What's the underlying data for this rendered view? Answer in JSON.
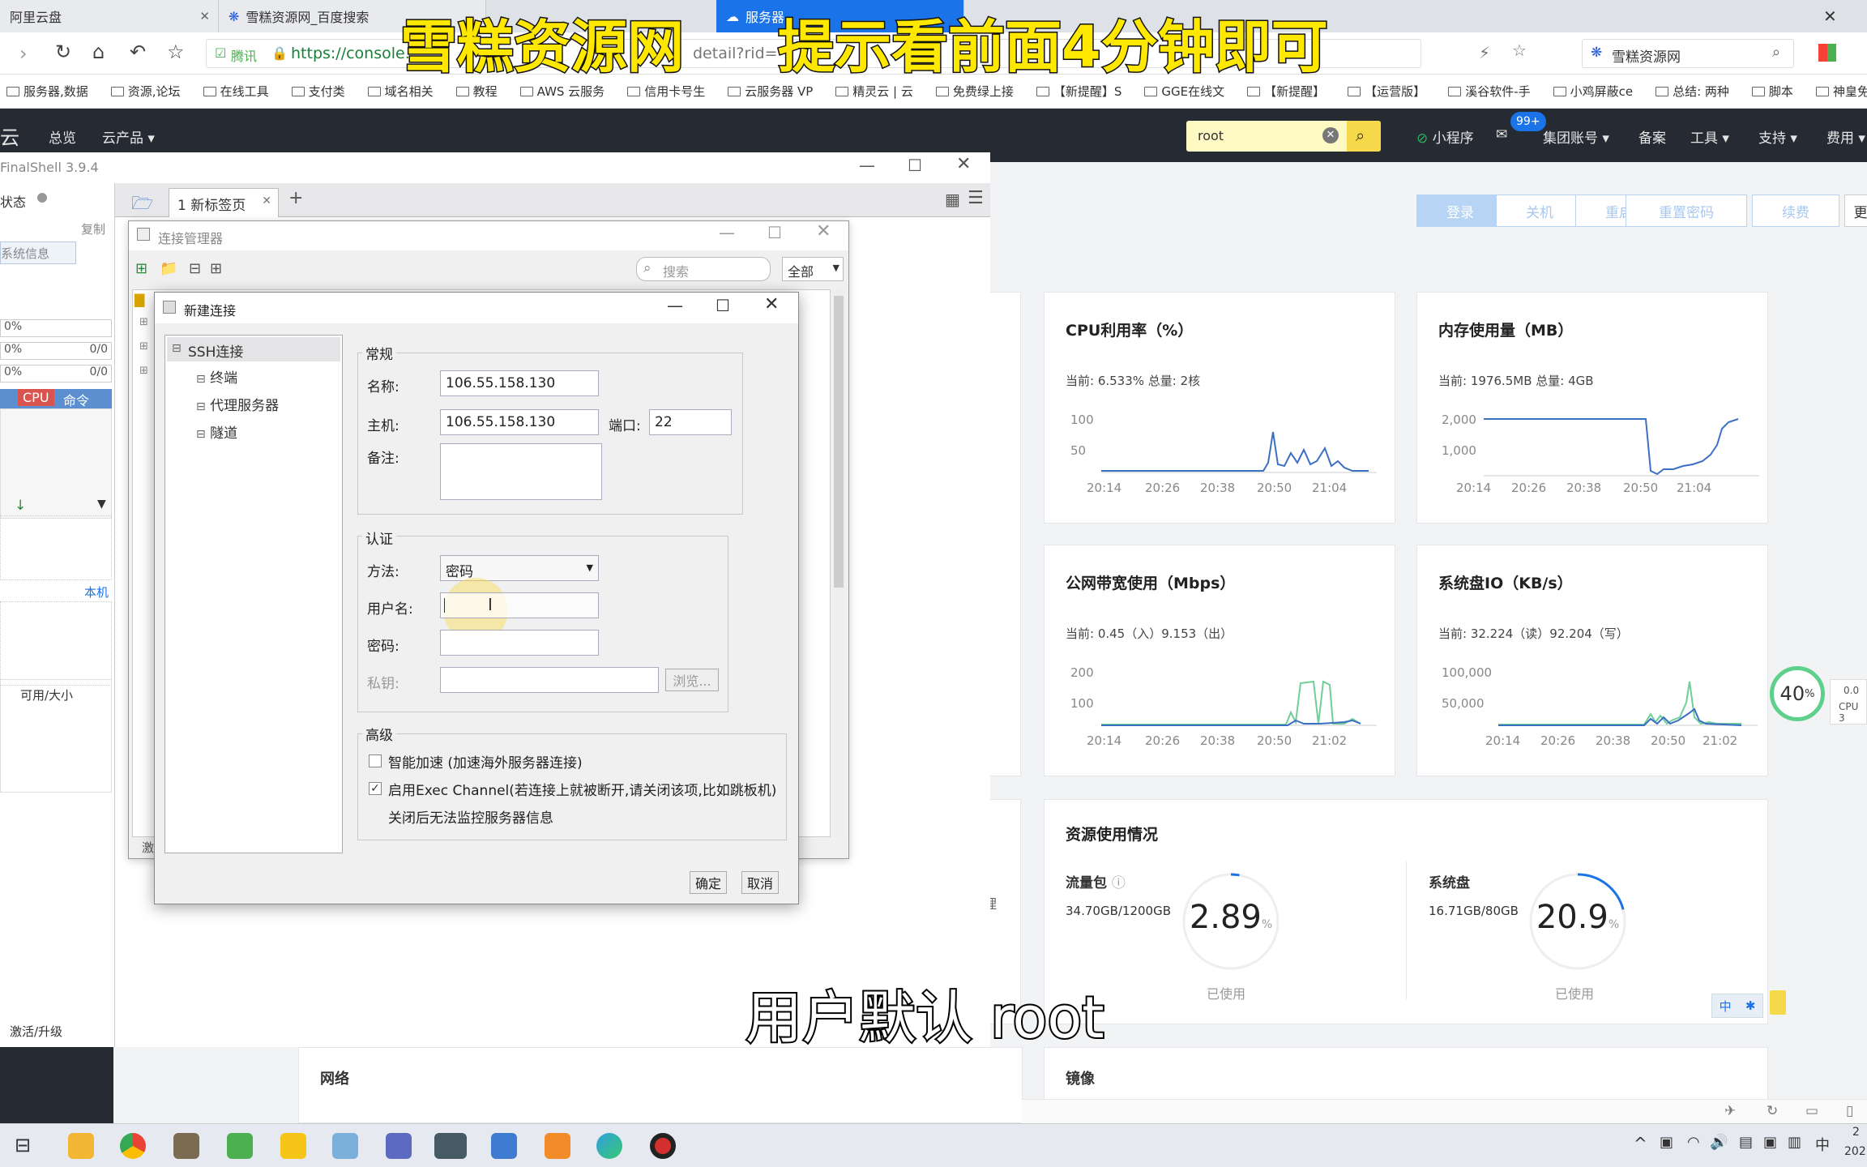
{
  "browser": {
    "tabs": [
      {
        "label": "阿里云盘"
      },
      {
        "label": "雪糕资源网_百度搜索"
      },
      {
        "label": "服务器"
      }
    ],
    "url": "https://console.",
    "url_suffix": "detail?rid=",
    "secure_label": "腾讯",
    "search_engine_label": "雪糕资源网",
    "bookmarks": [
      "服务器,数据",
      "资源,论坛",
      "在线工具",
      "支付类",
      "域名相关",
      "教程",
      "AWS 云服务",
      "信用卡号生",
      "云服务器 VP",
      "精灵云 | 云",
      "免费绿上接",
      "【新提醒】S",
      "GGE在线文",
      "【新提醒】",
      "【运营版】",
      "溪谷软件-手",
      "小鸡屏蔽ce",
      "总结: 两种",
      "脚本",
      "神皇免费"
    ]
  },
  "console": {
    "logo": "云",
    "nav": [
      "总览",
      "云产品"
    ],
    "search_value": "root",
    "right_items": [
      "小程序",
      "集团账号",
      "备案",
      "工具",
      "支持",
      "费用"
    ],
    "badge": "99+",
    "actions": [
      "登录",
      "关机",
      "重启",
      "重置密码",
      "续费",
      "更"
    ]
  },
  "cards": [
    {
      "title": "CPU利用率（%）",
      "current": "当前: 6.533% 总量: 2核",
      "yticks": [
        "100",
        "50"
      ],
      "xticks": [
        "20:14",
        "20:26",
        "20:38",
        "20:50",
        "21:04"
      ]
    },
    {
      "title": "内存使用量（MB）",
      "current": "当前: 1976.5MB 总量: 4GB",
      "yticks": [
        "2,000",
        "1,000"
      ],
      "xticks": [
        "20:14",
        "20:26",
        "20:38",
        "20:50",
        "21:04"
      ]
    },
    {
      "title": "公网带宽使用（Mbps）",
      "current": "当前: 0.45（入）9.153（出）",
      "yticks": [
        "200",
        "100"
      ],
      "xticks": [
        "20:14",
        "20:26",
        "20:38",
        "20:50",
        "21:02"
      ]
    },
    {
      "title": "系统盘IO（KB/s）",
      "current": "当前: 32.224（读）92.204（写）",
      "yticks": [
        "100,000",
        "50,000"
      ],
      "xticks": [
        "20:14",
        "20:26",
        "20:38",
        "20:50",
        "21:02"
      ]
    }
  ],
  "resources": {
    "title": "资源使用情况",
    "traffic": {
      "label": "流量包",
      "usage": "34.70GB/1200GB",
      "value": "2.89",
      "unit": "%",
      "used": "已使用",
      "percent": 2.89
    },
    "disk": {
      "label": "系统盘",
      "usage": "16.71GB/80GB",
      "value": "20.9",
      "unit": "%",
      "used": "已使用",
      "percent": 20.9
    }
  },
  "bottom_cards": [
    "网络",
    "镜像"
  ],
  "gauge": {
    "value": "40",
    "unit": "%",
    "side": "0.0",
    "side2": "CPU 3"
  },
  "finalshell": {
    "title": "FinalShell 3.9.4",
    "status": "状态",
    "copy": "复制",
    "sysinfo": "系统信息",
    "rows": [
      {
        "a": "0%",
        "b": ""
      },
      {
        "a": "0%",
        "b": "0/0"
      },
      {
        "a": "0%",
        "b": "0/0"
      }
    ],
    "cpu_tab": "CPU",
    "cmd_tab": "命令",
    "local": "本机",
    "avail": "可用/大小",
    "activate": "激活/升级",
    "tab_label": "1 新标签页",
    "side_char": "激"
  },
  "conn_manager": {
    "title": "连接管理器",
    "search_placeholder": "搜索",
    "filter": "全部"
  },
  "new_conn": {
    "title": "新建连接",
    "tree": {
      "root": "SSH连接",
      "children": [
        "终端",
        "代理服务器",
        "隧道"
      ]
    },
    "general": {
      "title": "常规",
      "name_label": "名称:",
      "name_value": "106.55.158.130",
      "host_label": "主机:",
      "host_value": "106.55.158.130",
      "port_label": "端口:",
      "port_value": "22",
      "note_label": "备注:"
    },
    "auth": {
      "title": "认证",
      "method_label": "方法:",
      "method_value": "密码",
      "user_label": "用户名:",
      "user_value": "",
      "pass_label": "密码:",
      "key_label": "私钥:",
      "browse": "浏览..."
    },
    "advanced": {
      "title": "高级",
      "opt1": "智能加速 (加速海外服务器连接)",
      "opt2": "启用Exec Channel(若连接上就被断开,请关闭该项,比如跳板机)",
      "opt2_note": "关闭后无法监控服务器信息"
    },
    "ok": "确定",
    "cancel": "取消"
  },
  "stray": "理",
  "ime": {
    "lang": "中"
  },
  "tray": {
    "lang": "中",
    "time": "2",
    "date": "202"
  },
  "overlay": {
    "title_left": "雪糕资源网",
    "title_right": "提示看前面4分钟即可",
    "subtitle": "用户默认 root"
  }
}
